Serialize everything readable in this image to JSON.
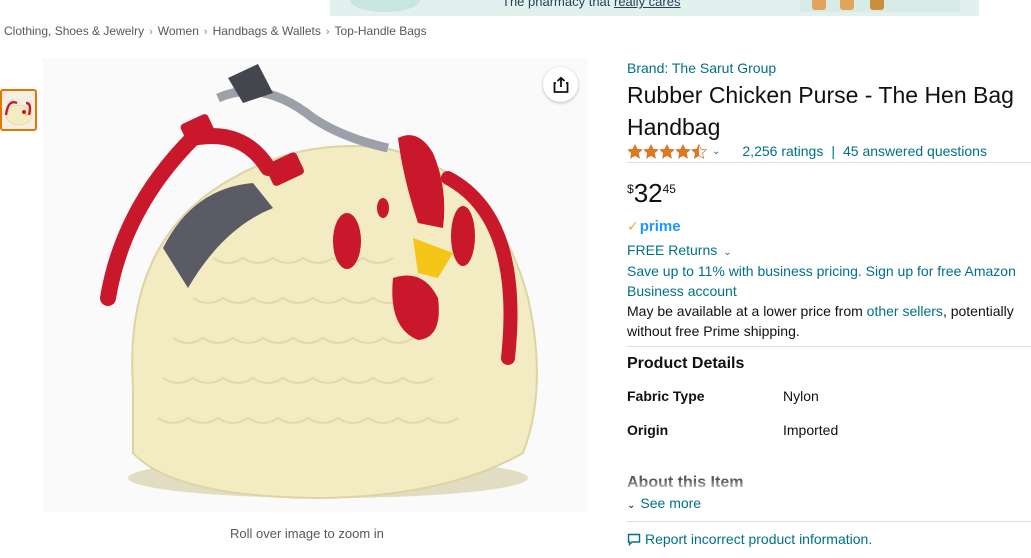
{
  "ad": {
    "text_prefix": "The pharmacy that ",
    "text_link": "really cares"
  },
  "breadcrumb": [
    "Clothing, Shoes & Jewelry",
    "Women",
    "Handbags & Wallets",
    "Top-Handle Bags"
  ],
  "gallery": {
    "zoom_hint": "Roll over image to zoom in",
    "share_icon": "share-icon"
  },
  "product": {
    "brand": "Brand: The Sarut Group",
    "title": "Rubber Chicken Purse - The Hen Bag Handbag",
    "rating_value": 4.5,
    "ratings_count": "2,256 ratings",
    "answered_questions": "45 answered questions",
    "price_symbol": "$",
    "price_whole": "32",
    "price_fraction": "45",
    "prime_label": "prime",
    "free_returns": "FREE Returns",
    "business_pricing": "Save up to 11% with business pricing. Sign up for free Amazon Business account",
    "availability_prefix": "May be available at a lower price from ",
    "availability_link": "other sellers",
    "availability_suffix": ", potentially without free Prime shipping."
  },
  "details": {
    "heading": "Product Details",
    "rows": [
      {
        "label": "Fabric Type",
        "value": "Nylon"
      },
      {
        "label": "Origin",
        "value": "Imported"
      }
    ]
  },
  "about": {
    "heading": "About this Item",
    "see_more": "See more"
  },
  "report_link": "Report incorrect product information.",
  "colors": {
    "link": "#007185",
    "star": "#de7921",
    "prime": "#1a98ff",
    "thumb_border": "#e77600",
    "bag_body": "#f3ebc2",
    "bag_handle": "#c9182b"
  }
}
